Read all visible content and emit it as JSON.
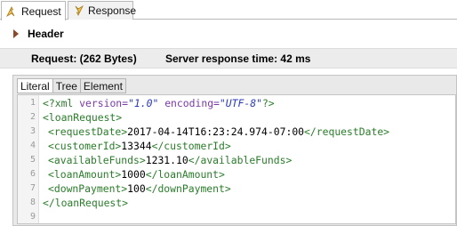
{
  "tabs": {
    "request_label": "Request",
    "response_label": "Response"
  },
  "header": {
    "title": "Header"
  },
  "info": {
    "request_size": "Request:  (262 Bytes)",
    "response_time": "Server response time: 42 ms"
  },
  "view_tabs": {
    "literal": "Literal",
    "tree": "Tree",
    "element": "Element"
  },
  "editor": {
    "line_numbers": [
      "1",
      "2",
      "3",
      "4",
      "5",
      "6",
      "7",
      "8",
      "9"
    ],
    "lines": {
      "l1": {
        "decl_open": "<?xml ",
        "attr1": "version=",
        "val1": "\"1.0\"",
        "sp": " ",
        "attr2": "encoding=",
        "val2": "\"UTF-8\"",
        "decl_close": "?>"
      },
      "l2": {
        "tag": "<loanRequest>"
      },
      "l3": {
        "open": "<requestDate>",
        "text": "2017-04-14T16:23:24.974-07:00",
        "close": "</requestDate>"
      },
      "l4": {
        "open": "<customerId>",
        "text": "13344",
        "close": "</customerId>"
      },
      "l5": {
        "open": "<availableFunds>",
        "text": "1231.10",
        "close": "</availableFunds>"
      },
      "l6": {
        "open": "<loanAmount>",
        "text": "1000",
        "close": "</loanAmount>"
      },
      "l7": {
        "open": "<downPayment>",
        "text": "100",
        "close": "</downPayment>"
      },
      "l8": {
        "tag": "</loanRequest>"
      }
    }
  },
  "colors": {
    "tag": "#2a7d2a",
    "attribute": "#7a3aa8",
    "string": "#2a3ab8",
    "info_bar_bg": "#ececec"
  },
  "icons": {
    "request_tab": "request-arrow-icon",
    "response_tab": "response-arrow-icon",
    "header_toggle": "chevron-right-icon"
  }
}
